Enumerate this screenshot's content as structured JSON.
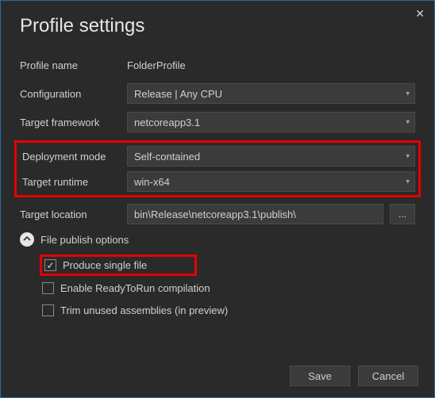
{
  "title": "Profile settings",
  "fields": {
    "profileName": {
      "label": "Profile name",
      "value": "FolderProfile"
    },
    "configuration": {
      "label": "Configuration",
      "value": "Release | Any CPU"
    },
    "targetFramework": {
      "label": "Target framework",
      "value": "netcoreapp3.1"
    },
    "deploymentMode": {
      "label": "Deployment mode",
      "value": "Self-contained"
    },
    "targetRuntime": {
      "label": "Target runtime",
      "value": "win-x64"
    },
    "targetLocation": {
      "label": "Target location",
      "value": "bin\\Release\\netcoreapp3.1\\publish\\"
    }
  },
  "browseLabel": "...",
  "expander": {
    "label": "File publish options"
  },
  "checkboxes": {
    "singleFile": "Produce single file",
    "readyToRun": "Enable ReadyToRun compilation",
    "trim": "Trim unused assemblies (in preview)"
  },
  "buttons": {
    "save": "Save",
    "cancel": "Cancel"
  }
}
